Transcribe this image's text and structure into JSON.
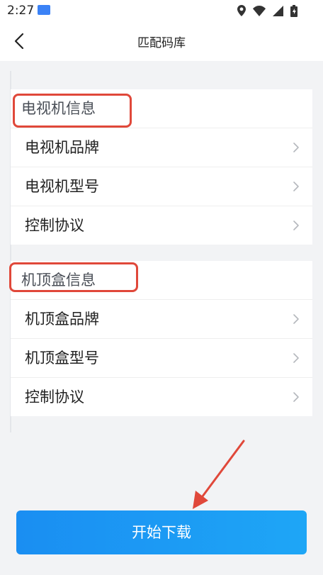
{
  "status_bar": {
    "time": "2:27",
    "icons": [
      "notification-icon",
      "location-icon",
      "wifi-icon",
      "signal-icon",
      "battery-icon"
    ]
  },
  "header": {
    "title": "匹配码库",
    "back_icon": "chevron-left-icon"
  },
  "tv_section": {
    "title": "电视机信息",
    "items": [
      {
        "label": "电视机品牌"
      },
      {
        "label": "电视机型号"
      },
      {
        "label": "控制协议"
      }
    ]
  },
  "stb_section": {
    "title": "机顶盒信息",
    "items": [
      {
        "label": "机顶盒品牌"
      },
      {
        "label": "机顶盒型号"
      },
      {
        "label": "控制协议"
      }
    ]
  },
  "download_button": {
    "label": "开始下载"
  },
  "colors": {
    "accent": "#1a8ef2",
    "highlight": "#e0483a",
    "background": "#f2f3f5"
  }
}
